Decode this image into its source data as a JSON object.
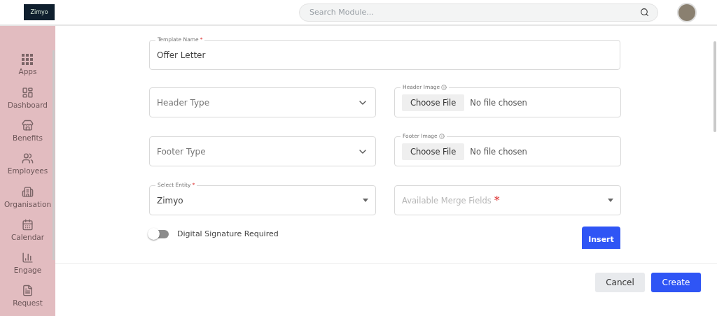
{
  "header": {
    "logo": "Zimyo",
    "search": {
      "placeholder": "Search Module..."
    }
  },
  "sidebar": {
    "items": [
      {
        "label": "Apps",
        "kind": "apps"
      },
      {
        "label": "Dashboard",
        "kind": "dashboard"
      },
      {
        "label": "Benefits",
        "kind": "benefits"
      },
      {
        "label": "Employees",
        "kind": "employees"
      },
      {
        "label": "Organisation",
        "kind": "organisation"
      },
      {
        "label": "Calendar",
        "kind": "calendar"
      },
      {
        "label": "Engage",
        "kind": "engage"
      },
      {
        "label": "Request",
        "kind": "request"
      }
    ]
  },
  "form": {
    "template_name": {
      "label": "Template Name",
      "required_mark": "*",
      "value": "Offer Letter"
    },
    "header_type": {
      "placeholder": "Header Type"
    },
    "header_image": {
      "label": "Header Image",
      "button": "Choose File",
      "status": "No file chosen"
    },
    "footer_type": {
      "placeholder": "Footer Type"
    },
    "footer_image": {
      "label": "Footer Image",
      "button": "Choose File",
      "status": "No file chosen"
    },
    "entity": {
      "label": "Select Entity",
      "required_mark": "*",
      "value": "Zimyo"
    },
    "merge_fields": {
      "placeholder": "Available Merge Fields",
      "required_mark": "*"
    },
    "digital_signature": {
      "label": "Digital Signature Required",
      "on": false
    },
    "insert_button": "Insert"
  },
  "actions": [
    {
      "label": "Cancel",
      "kind": "secondary"
    },
    {
      "label": "Create",
      "kind": "primary"
    }
  ]
}
